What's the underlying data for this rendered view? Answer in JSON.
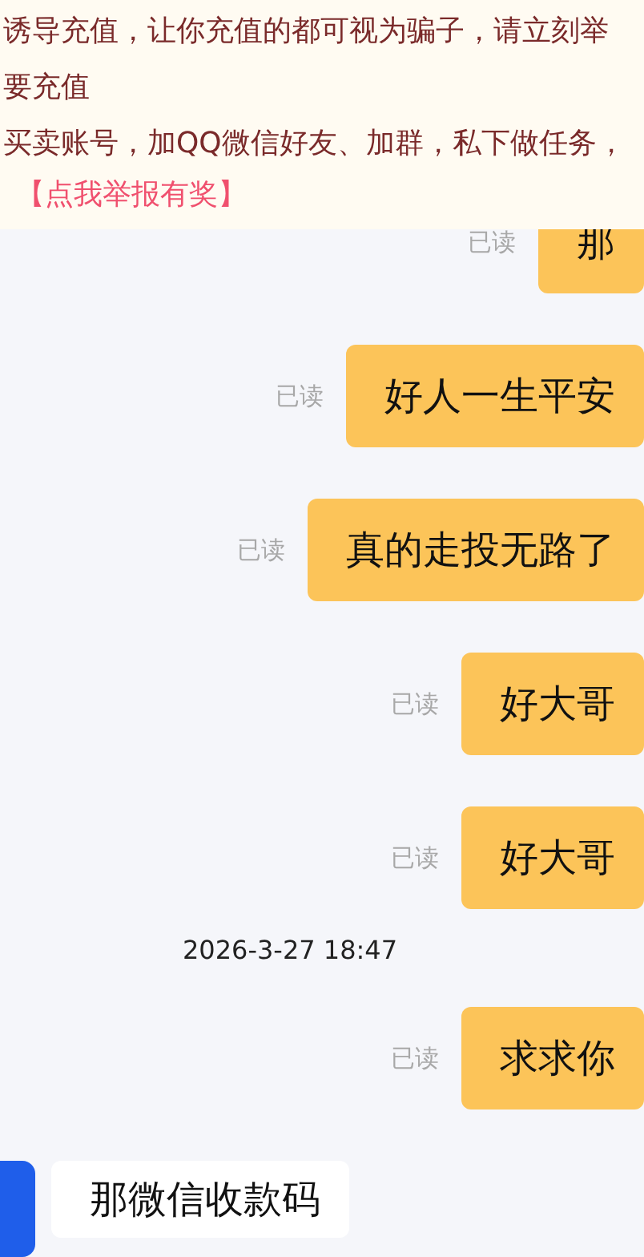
{
  "notice": {
    "lines": [
      "诱导充值，让你充值的都可视为骗子，请立刻举",
      "要充值",
      "买卖账号，加QQ微信好友、加群，私下做任务，"
    ],
    "link": "【点我举报有奖】"
  },
  "messages": [
    {
      "kind": "sent",
      "text": "那",
      "status": "已读"
    },
    {
      "kind": "sent",
      "text": "好人一生平安",
      "status": "已读"
    },
    {
      "kind": "sent",
      "text": "真的走投无路了",
      "status": "已读"
    },
    {
      "kind": "sent",
      "text": "好大哥",
      "status": "已读"
    },
    {
      "kind": "sent",
      "text": "好大哥",
      "status": "已读"
    },
    {
      "kind": "time",
      "text": "2026-3-27 18:47"
    },
    {
      "kind": "sent",
      "text": "求求你",
      "status": "已读"
    },
    {
      "kind": "received",
      "text": "那微信收款码"
    }
  ]
}
